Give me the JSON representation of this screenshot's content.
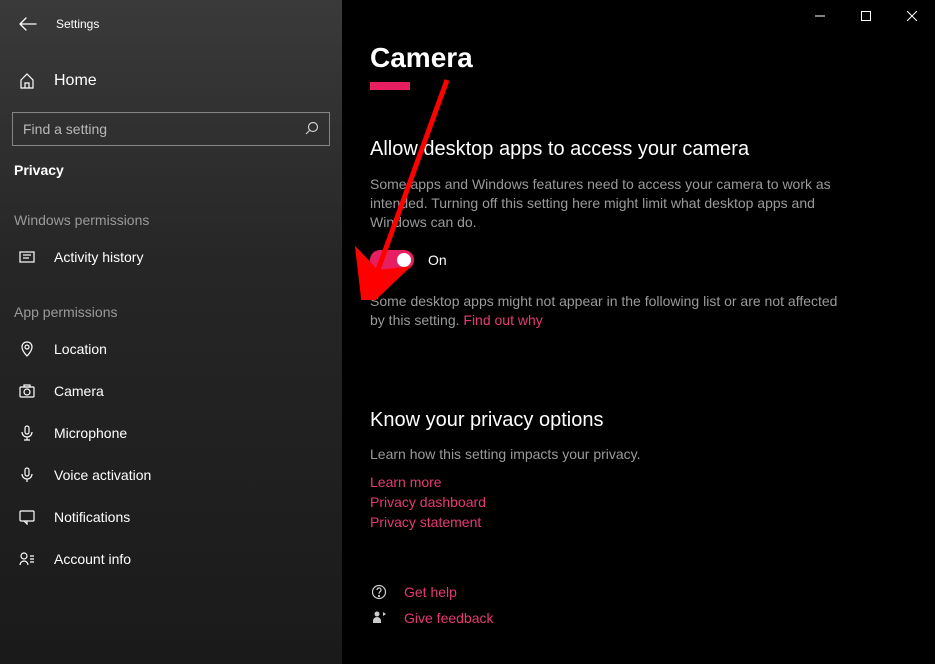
{
  "titlebar": {
    "app_name": "Settings"
  },
  "sidebar": {
    "home": "Home",
    "search_placeholder": "Find a setting",
    "active": "Privacy",
    "winperm_label": "Windows permissions",
    "winperm_items": [
      {
        "label": "Activity history"
      }
    ],
    "appperm_label": "App permissions",
    "appperm_items": [
      {
        "label": "Location"
      },
      {
        "label": "Camera"
      },
      {
        "label": "Microphone"
      },
      {
        "label": "Voice activation"
      },
      {
        "label": "Notifications"
      },
      {
        "label": "Account info"
      }
    ]
  },
  "main": {
    "title": "Camera",
    "sec1_heading": "Allow desktop apps to access your camera",
    "sec1_desc": "Some apps and Windows features need to access your camera to work as intended. Turning off this setting here might limit what desktop apps and Windows can do.",
    "toggle_state": "On",
    "after_toggle": "Some desktop apps might not appear in the following list or are not affected by this setting. ",
    "find_out": "Find out why",
    "sec2_heading": "Know your privacy options",
    "sec2_desc": "Learn how this setting impacts your privacy.",
    "links": [
      "Learn more",
      "Privacy dashboard",
      "Privacy statement"
    ],
    "help": "Get help",
    "feedback": "Give feedback"
  }
}
